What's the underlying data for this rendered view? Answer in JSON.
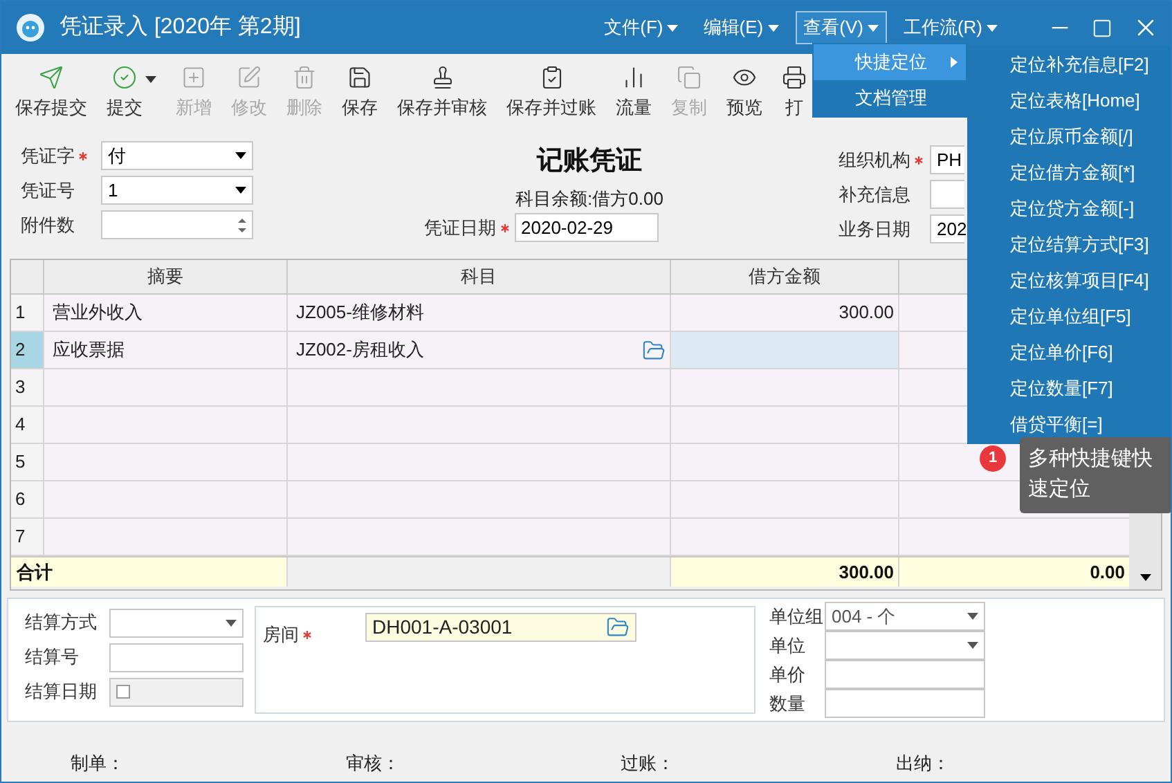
{
  "window": {
    "title": "凭证录入 [2020年 第2期]",
    "menus": [
      {
        "label": "文件(F)",
        "selected": false
      },
      {
        "label": "编辑(E)",
        "selected": false
      },
      {
        "label": "查看(V)",
        "selected": true
      },
      {
        "label": "工作流(R)",
        "selected": false
      }
    ]
  },
  "toolbar": [
    {
      "label": "保存提交",
      "disabled": false,
      "caret": false
    },
    {
      "label": "提交",
      "disabled": false,
      "caret": true
    },
    {
      "label": "新增",
      "disabled": true,
      "caret": false
    },
    {
      "label": "修改",
      "disabled": true,
      "caret": false
    },
    {
      "label": "删除",
      "disabled": true,
      "caret": false
    },
    {
      "label": "保存",
      "disabled": false,
      "caret": false
    },
    {
      "label": "保存并审核",
      "disabled": false,
      "caret": false
    },
    {
      "label": "保存并过账",
      "disabled": false,
      "caret": false
    },
    {
      "label": "流量",
      "disabled": false,
      "caret": false
    },
    {
      "label": "复制",
      "disabled": true,
      "caret": false
    },
    {
      "label": "预览",
      "disabled": false,
      "caret": false
    },
    {
      "label": "打",
      "disabled": false,
      "caret": false
    }
  ],
  "form": {
    "title": "记账凭证",
    "balance": "科目余额:借方0.00",
    "left": [
      {
        "label": "凭证字",
        "required": true,
        "value": "付",
        "kind": "select"
      },
      {
        "label": "凭证号",
        "required": false,
        "value": "1",
        "kind": "select"
      },
      {
        "label": "附件数",
        "required": false,
        "kind": "spin"
      }
    ],
    "date": {
      "label": "凭证日期",
      "required": true,
      "value": "2020-02-29"
    },
    "right": [
      {
        "label": "组织机构",
        "required": true,
        "value": "PH"
      },
      {
        "label": "补充信息",
        "required": false
      },
      {
        "label": "业务日期",
        "required": false,
        "value": "202"
      }
    ]
  },
  "table": {
    "columns": [
      "摘要",
      "科目",
      "借方金额"
    ],
    "rows": [
      {
        "no": "1",
        "summary": "营业外收入",
        "account": "JZ005-维修材料",
        "debit": "300.00",
        "selected": false,
        "folder": false
      },
      {
        "no": "2",
        "summary": "应收票据",
        "account": "JZ002-房租收入",
        "selected": true,
        "folder": true
      },
      {
        "no": "3",
        "selected": false,
        "folder": false
      },
      {
        "no": "4",
        "selected": false,
        "folder": false
      },
      {
        "no": "5",
        "selected": false,
        "folder": false
      },
      {
        "no": "6",
        "selected": false,
        "folder": false
      },
      {
        "no": "7",
        "selected": false,
        "folder": false
      }
    ],
    "total": {
      "label": "合计",
      "debit": "300.00",
      "credit": "0.00"
    }
  },
  "detail": {
    "left": [
      {
        "label": "结算方式",
        "kind": "select"
      },
      {
        "label": "结算号",
        "kind": "text"
      },
      {
        "label": "结算日期",
        "kind": "date",
        "checked": false
      }
    ],
    "room": {
      "label": "房间",
      "required": true,
      "value": "DH001-A-03001"
    },
    "right": [
      {
        "label": "单位组",
        "kind": "select",
        "value": "004 - 个"
      },
      {
        "label": "单位",
        "kind": "select"
      },
      {
        "label": "单价",
        "kind": "text"
      },
      {
        "label": "数量",
        "kind": "text"
      }
    ]
  },
  "footer": [
    "制单：",
    "审核：",
    "过账：",
    "出纳："
  ],
  "view_menu": [
    {
      "label": "快捷定位",
      "selected": true,
      "submenu": true
    },
    {
      "label": "文档管理",
      "selected": false,
      "submenu": false
    }
  ],
  "submenu": [
    "定位补充信息[F2]",
    "定位表格[Home]",
    "定位原币金额[/]",
    "定位借方金额[*]",
    "定位贷方金额[-]",
    "定位结算方式[F3]",
    "定位核算项目[F4]",
    "定位单位组[F5]",
    "定位单价[F6]",
    "定位数量[F7]",
    "借贷平衡[=]"
  ],
  "tooltip": {
    "badge": "1",
    "text": "多种快捷键快速定位"
  }
}
